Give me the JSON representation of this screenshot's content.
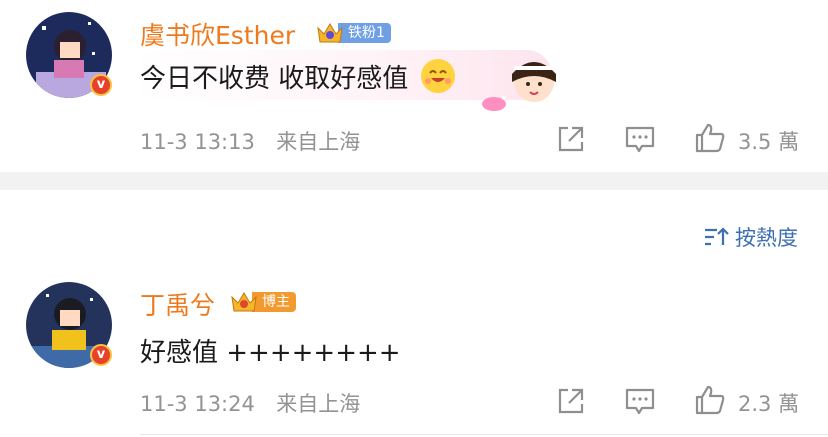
{
  "comments": [
    {
      "username": "虞书欣Esther",
      "badge_label": "铁粉1",
      "text": "今日不收费 收取好感值",
      "time": "11-3 13:13",
      "location": "来自上海",
      "likes": "3.5 萬"
    },
    {
      "username": "丁禹兮",
      "badge_label": "博主",
      "text": "好感值 ++++++++",
      "time": "11-3 13:24",
      "location": "来自上海",
      "likes": "2.3 萬"
    }
  ],
  "sort": {
    "label": "按熱度"
  },
  "colors": {
    "username": "#ef7a1e",
    "meta": "#939393",
    "sort": "#3c6fb4",
    "fan_badge": "#6fa0e6",
    "host_badge": "#f29a2e",
    "divider": "#f2f2f2"
  },
  "icons": [
    "verified-icon",
    "crown-icon",
    "smile-emoji-icon",
    "share-icon",
    "comment-icon",
    "like-icon",
    "sort-icon"
  ]
}
